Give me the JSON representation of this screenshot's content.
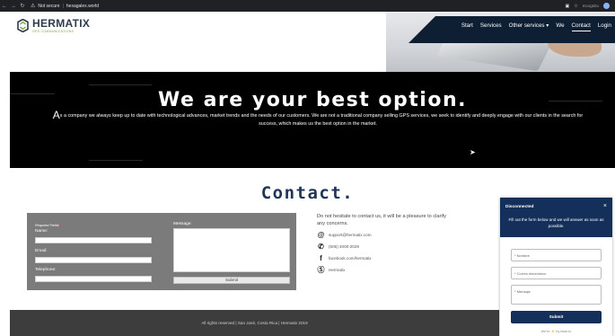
{
  "browser": {
    "not_secure_label": "Not secure",
    "url": "hexagalex.world",
    "incognito_label": "Incognito"
  },
  "header": {
    "logo_text": "HERMATIX",
    "logo_tagline": "GPS COMMUNICATIONS",
    "nav": [
      {
        "label": "Start"
      },
      {
        "label": "Services"
      },
      {
        "label": "Other services ▾"
      },
      {
        "label": "We"
      },
      {
        "label": "Contact"
      },
      {
        "label": "Login"
      }
    ]
  },
  "banner": {
    "headline": "We are your best option.",
    "lead_letter": "A",
    "body": "s a company we always keep up to date with technological advances, market trends and the needs of our customers. We are not a traditional company selling GPS services, we seek to identify and deeply engage with our clients in the search for success, which makes us the best option in the market."
  },
  "contact": {
    "title": "Contact.",
    "form": {
      "required_note": "Required Fields",
      "name_label": "Name:",
      "email_label": "Email:",
      "telephone_label": "Telephone:",
      "message_label": "Message:",
      "submit_label": "Submit"
    },
    "info": {
      "intro": "Do not hesitate to contact us, it will be a pleasure to clarify any concerns.",
      "email": "support@hermatix.com",
      "phone": "(506) 4000-2029",
      "facebook": "facebook.com/hermatix",
      "skype": "Hermatix"
    }
  },
  "footer": {
    "text": "All rights reserved | San José, Costa Rica | Hermatix 2019"
  },
  "chat": {
    "status": "Disconnected",
    "message": "Fill out the form below and we will answer as soon as possible.",
    "name_placeholder": "* Nombre",
    "email_placeholder": "* Correo electrónico",
    "message_placeholder": "* Mensaje",
    "send_label": "Submit",
    "brand": "We're ⚡ by tawk.to"
  },
  "colors": {
    "brand_navy": "#14305a",
    "title_navy": "#1f3559",
    "banner_bg": "#000000",
    "form_bg": "#7b7b7b",
    "footer_bg": "#3d3d3d"
  }
}
